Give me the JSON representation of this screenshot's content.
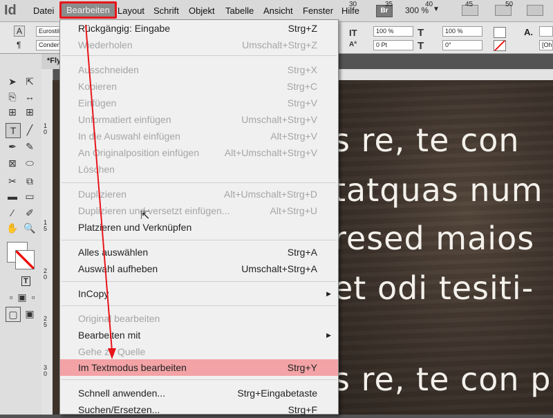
{
  "app": {
    "logo": "Id"
  },
  "menubar": {
    "items": [
      "Datei",
      "Bearbeiten",
      "Layout",
      "Schrift",
      "Objekt",
      "Tabelle",
      "Ansicht",
      "Fenster",
      "Hilfe"
    ],
    "bridge_label": "Br",
    "zoom": "300 %",
    "zoom_arrow": "▼"
  },
  "controlbar": {
    "font": "Eurostil",
    "font_style": "Conden",
    "scale_vertical": "100 %",
    "scale_horizontal": "100 %",
    "baseline_shift": "0 Pt",
    "skew": "0°",
    "right_field": "[Ohn",
    "glyph_a": "A",
    "glyph_para": "¶",
    "glyph_it": "IT",
    "glyph_t": "T",
    "glyph_aa": "Aª",
    "glyph_t2": "T",
    "glyph_a_right": "A."
  },
  "document": {
    "tab": "*Fly",
    "ruler_h": [
      "30",
      "35",
      "40",
      "45",
      "50"
    ],
    "ruler_v": [
      "1\n0",
      "1\n5",
      "2\n0",
      "2\n5",
      "3\n0"
    ],
    "lines": [
      "s re, te con",
      "tatquas num",
      "resed maios",
      "et odi tesiti-",
      "s re, te con pe"
    ]
  },
  "toolbox": {
    "tools": {
      "select": "➤",
      "direct": "⇱",
      "page": "⎘",
      "gap": "↔",
      "content1": "⊞",
      "content2": "⊞",
      "type": "T",
      "line": "╱",
      "pen": "✒",
      "pencil": "✎",
      "rectframe": "⊠",
      "ellipse": "⬭",
      "scissors": "✂",
      "transform": "⧉",
      "gradient": "▬",
      "gradfeather": "▭",
      "eyedrop": "⁄",
      "measure": "✐",
      "hand": "✋",
      "zoomtool": "🔍",
      "mode1": "▫",
      "mode2": "▣",
      "mode3": "▫",
      "screen1": "▢",
      "screen2": "▣"
    },
    "text_mode": "T"
  },
  "edit_menu": {
    "items": [
      {
        "label": "Rückgängig: Eingabe",
        "shortcut": "Strg+Z",
        "enabled": true
      },
      {
        "label": "Wiederholen",
        "shortcut": "Umschalt+Strg+Z",
        "enabled": false
      },
      {
        "label": "Ausschneiden",
        "shortcut": "Strg+X",
        "enabled": false
      },
      {
        "label": "Kopieren",
        "shortcut": "Strg+C",
        "enabled": false
      },
      {
        "label": "Einfügen",
        "shortcut": "Strg+V",
        "enabled": false
      },
      {
        "label": "Unformatiert einfügen",
        "shortcut": "Umschalt+Strg+V",
        "enabled": false
      },
      {
        "label": "In die Auswahl einfügen",
        "shortcut": "Alt+Strg+V",
        "enabled": false
      },
      {
        "label": "An Originalposition einfügen",
        "shortcut": "Alt+Umschalt+Strg+V",
        "enabled": false
      },
      {
        "label": "Löschen",
        "shortcut": "",
        "enabled": false
      },
      {
        "label": "Duplizieren",
        "shortcut": "Alt+Umschalt+Strg+D",
        "enabled": false
      },
      {
        "label": "Duplizieren und versetzt einfügen...",
        "shortcut": "Alt+Strg+U",
        "enabled": false
      },
      {
        "label": "Platzieren und Verknüpfen",
        "shortcut": "",
        "enabled": true
      },
      {
        "label": "Alles auswählen",
        "shortcut": "Strg+A",
        "enabled": true
      },
      {
        "label": "Auswahl aufheben",
        "shortcut": "Umschalt+Strg+A",
        "enabled": true
      },
      {
        "label": "InCopy",
        "shortcut": "",
        "enabled": true,
        "submenu": "▶"
      },
      {
        "label": "Original bearbeiten",
        "shortcut": "",
        "enabled": false
      },
      {
        "label": "Bearbeiten mit",
        "shortcut": "",
        "enabled": true,
        "submenu": "▶"
      },
      {
        "label": "Gehe zu Quelle",
        "shortcut": "",
        "enabled": false
      },
      {
        "label": "Im Textmodus bearbeiten",
        "shortcut": "Strg+Y",
        "enabled": true,
        "highlighted": true
      },
      {
        "label": "Schnell anwenden...",
        "shortcut": "Strg+Eingabetaste",
        "enabled": true
      },
      {
        "label": "Suchen/Ersetzen...",
        "shortcut": "Strg+F",
        "enabled": true
      }
    ]
  },
  "colors": {
    "highlight": "#f3a3a6",
    "annotation_red": "#e8141a",
    "disabled_text": "#a5a5a5"
  }
}
